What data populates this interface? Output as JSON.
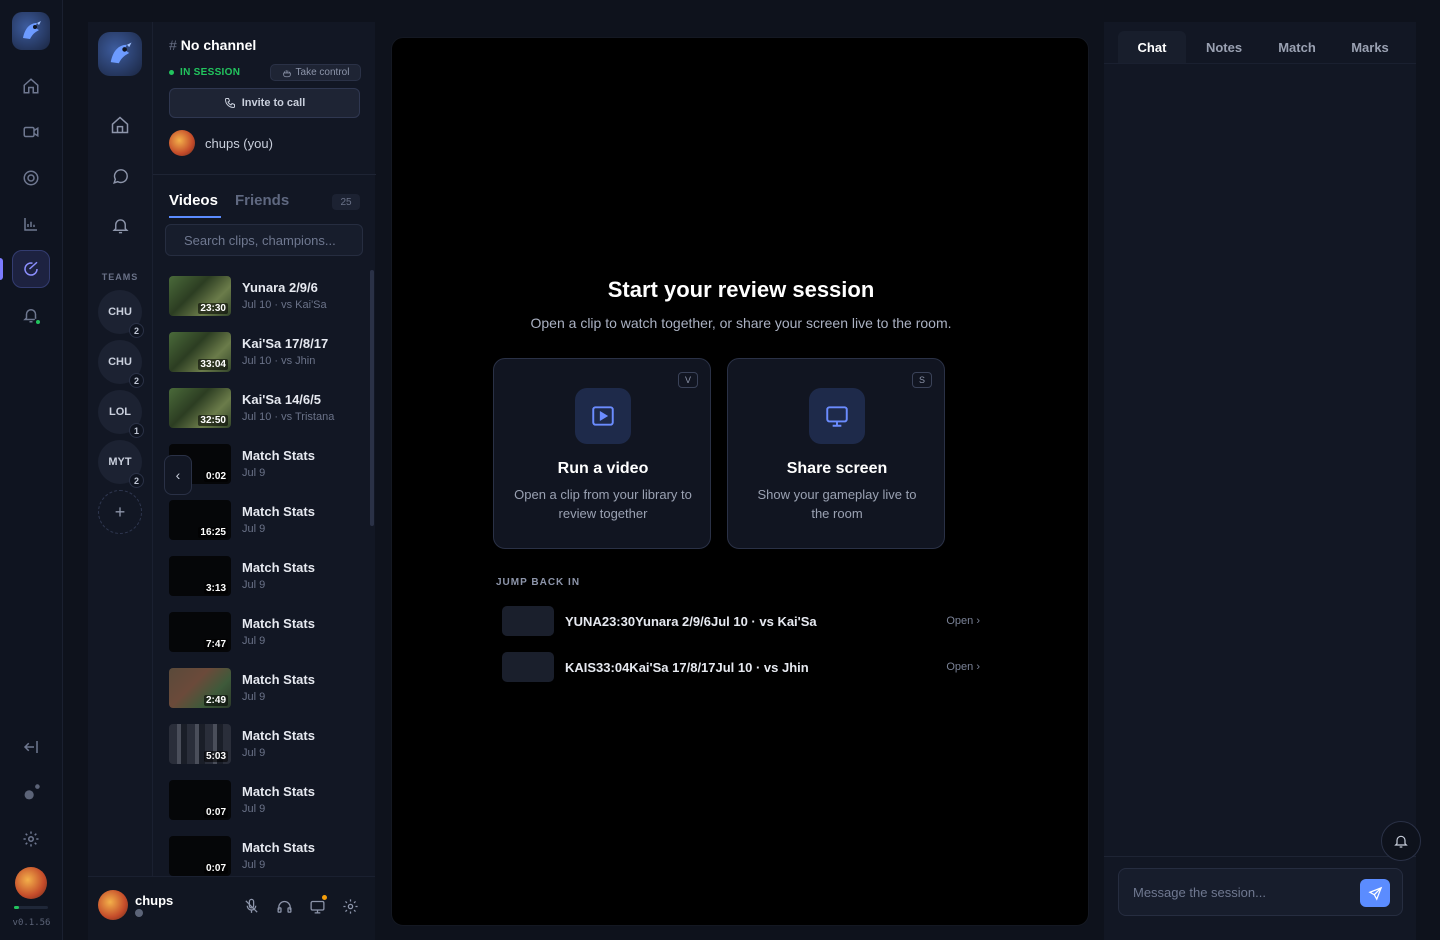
{
  "rail": {
    "version": "v0.1.56",
    "icons": [
      "app-logo",
      "home-icon",
      "video-icon",
      "target-icon",
      "bar-chart-icon",
      "review-icon",
      "notification-icon",
      "logout-icon",
      "dot-icon",
      "settings-icon"
    ]
  },
  "teams_column": {
    "label": "TEAMS",
    "teams": [
      {
        "name": "CHU",
        "badge": "2"
      },
      {
        "name": "CHU",
        "badge": "2"
      },
      {
        "name": "LOL",
        "badge": "1"
      },
      {
        "name": "MYT",
        "badge": "2"
      }
    ],
    "add_label": "+"
  },
  "channel": {
    "hash": "#",
    "title": "No channel",
    "session_status": "IN SESSION",
    "take_control": "Take control",
    "invite": "Invite to call",
    "me": "chups (you)",
    "tabs": {
      "videos": "Videos",
      "friends": "Friends",
      "count": "25"
    },
    "search_placeholder": "Search clips, champions...",
    "videos": [
      {
        "title": "Yunara 2/9/6",
        "sub": "Jul 10 · vs Kai'Sa",
        "duration": "23:30",
        "thumb": "game"
      },
      {
        "title": "Kai'Sa 17/8/17",
        "sub": "Jul 10 · vs Jhin",
        "duration": "33:04",
        "thumb": "game"
      },
      {
        "title": "Kai'Sa 14/6/5",
        "sub": "Jul 10 · vs Tristana",
        "duration": "32:50",
        "thumb": "game"
      },
      {
        "title": "Match Stats",
        "sub": "Jul 9",
        "duration": "0:02",
        "thumb": "dark"
      },
      {
        "title": "Match Stats",
        "sub": "Jul 9",
        "duration": "16:25",
        "thumb": "dark"
      },
      {
        "title": "Match Stats",
        "sub": "Jul 9",
        "duration": "3:13",
        "thumb": "dark"
      },
      {
        "title": "Match Stats",
        "sub": "Jul 9",
        "duration": "7:47",
        "thumb": "dark"
      },
      {
        "title": "Match Stats",
        "sub": "Jul 9",
        "duration": "2:49",
        "thumb": "game2"
      },
      {
        "title": "Match Stats",
        "sub": "Jul 9",
        "duration": "5:03",
        "thumb": "game3"
      },
      {
        "title": "Match Stats",
        "sub": "Jul 9",
        "duration": "0:07",
        "thumb": "dark"
      },
      {
        "title": "Match Stats",
        "sub": "Jul 9",
        "duration": "0:07",
        "thumb": "dark"
      }
    ],
    "collapse_label": "‹"
  },
  "userbar": {
    "name": "chups"
  },
  "stage": {
    "title": "Start your review session",
    "subtitle": "Open a clip to watch together, or share your screen live to the room.",
    "cards": [
      {
        "key": "V",
        "title": "Run a video",
        "desc": "Open a clip from your library to review together"
      },
      {
        "key": "S",
        "title": "Share screen",
        "desc": "Show your gameplay live to the room"
      }
    ],
    "jump_label": "JUMP BACK IN",
    "jump_items": [
      {
        "text": "YUNA23:30Yunara 2/9/6Jul 10 · vs Kai'Sa",
        "open": "Open ›"
      },
      {
        "text": "KAIS33:04Kai'Sa 17/8/17Jul 10 · vs Jhin",
        "open": "Open ›"
      }
    ]
  },
  "rpanel": {
    "tabs": [
      "Chat",
      "Notes",
      "Match",
      "Marks"
    ],
    "message_placeholder": "Message the session..."
  },
  "colors": {
    "accent": "#5b8cff",
    "active_rail": "#8c8fff",
    "online": "#22c55e"
  }
}
